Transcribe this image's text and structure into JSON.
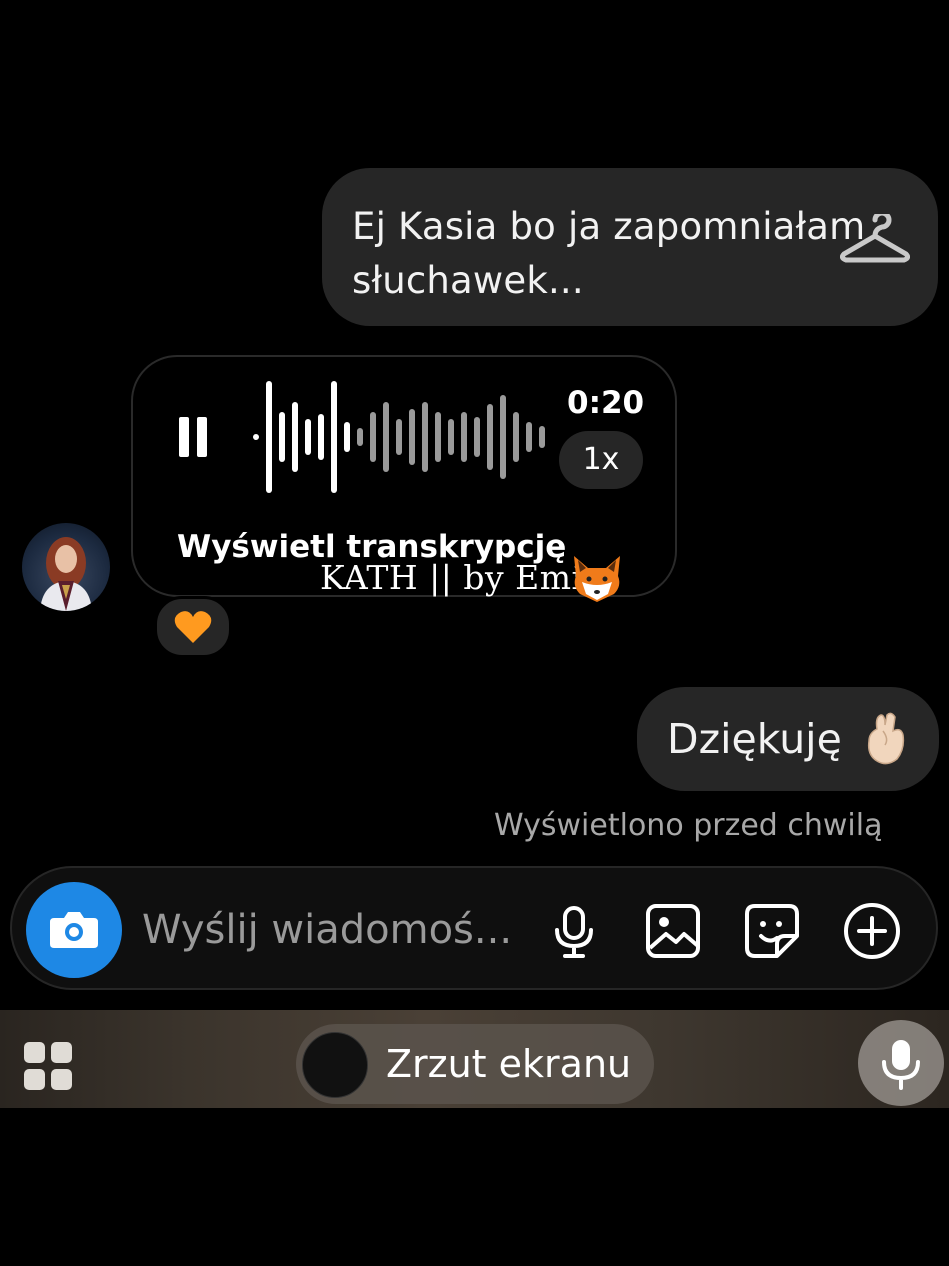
{
  "messages": {
    "outgoing_1": "Ej Kasia bo ja zapomniałam słuchawek...",
    "voice": {
      "duration": "0:20",
      "speed": "1x",
      "transcript_label": "Wyświetl transkrypcję"
    },
    "reaction": "orange-heart",
    "outgoing_2": "Dziękuję",
    "seen_status": "Wyświetlono przed chwilą"
  },
  "watermark": "KATH || by Emi",
  "composer": {
    "placeholder": "Wyślij wiadomoś..."
  },
  "bottom_bar": {
    "pill_label": "Zrzut ekranu"
  },
  "icons": {
    "camera": "camera-icon",
    "mic": "microphone-icon",
    "gallery": "gallery-icon",
    "sticker": "sticker-icon",
    "plus": "plus-icon",
    "grid": "grid-icon"
  },
  "colors": {
    "bubble": "#262626",
    "accent": "#1e88e5",
    "muted": "#a8a8a8"
  }
}
